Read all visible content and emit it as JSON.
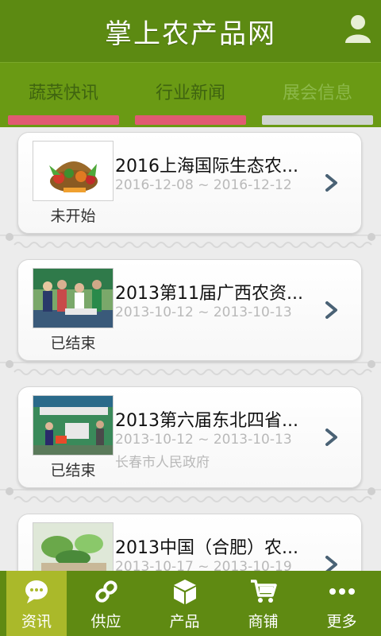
{
  "app": {
    "title": "掌上农产品网"
  },
  "tabs": [
    {
      "label": "蔬菜快讯",
      "active": false
    },
    {
      "label": "行业新闻",
      "active": false
    },
    {
      "label": "展会信息",
      "active": true
    }
  ],
  "items": [
    {
      "title": "2016上海国际生态农...",
      "date": "2016-12-08 ~ 2016-12-12",
      "org": "",
      "status": "未开始"
    },
    {
      "title": "2013第11届广西农资...",
      "date": "2013-10-12 ~ 2013-10-13",
      "org": "",
      "status": "已结束"
    },
    {
      "title": "2013第六届东北四省...",
      "date": "2013-10-12 ~ 2013-10-13",
      "org": "长春市人民政府",
      "status": "已结束"
    },
    {
      "title": "2013中国（合肥）农...",
      "date": "2013-10-17 ~ 2013-10-19",
      "org": "",
      "status": ""
    }
  ],
  "nav": [
    {
      "label": "资讯",
      "icon": "chat-icon",
      "active": true
    },
    {
      "label": "供应",
      "icon": "link-icon",
      "active": false
    },
    {
      "label": "产品",
      "icon": "box-icon",
      "active": false
    },
    {
      "label": "商铺",
      "icon": "cart-icon",
      "active": false
    },
    {
      "label": "更多",
      "icon": "more-icon",
      "active": false
    }
  ],
  "colors": {
    "header": "#5c8a12",
    "tab_bar": "#e05a72",
    "nav_active": "#aab92a"
  }
}
